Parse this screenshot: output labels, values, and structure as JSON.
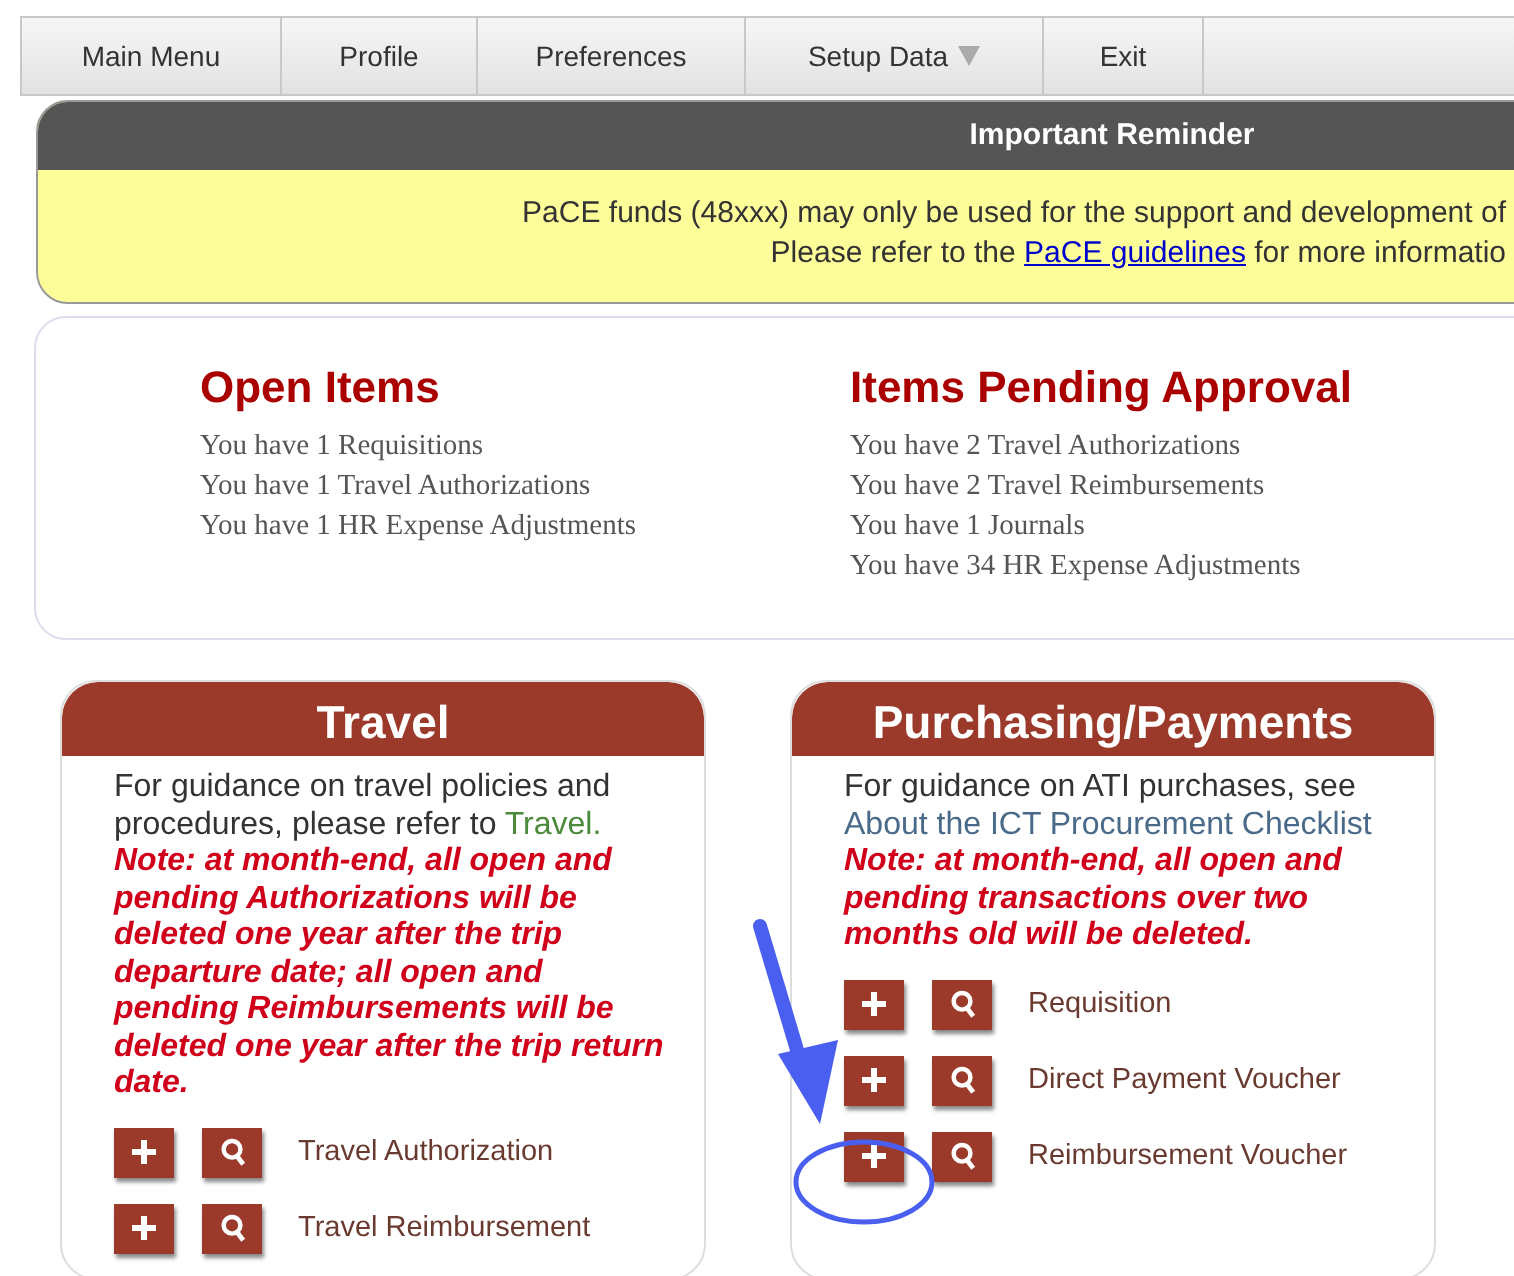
{
  "menu": [
    {
      "label": "Main Menu",
      "dropdown": false
    },
    {
      "label": "Profile",
      "dropdown": false
    },
    {
      "label": "Preferences",
      "dropdown": false
    },
    {
      "label": "Setup Data",
      "dropdown": true
    },
    {
      "label": "Exit",
      "dropdown": false
    }
  ],
  "reminder": {
    "title": "Important Reminder",
    "line_1": "PaCE funds (48xxx) may only be used for the support and development of",
    "line_2_before": "Please refer to the",
    "line_2_link": "PaCE guidelines",
    "line_2_after": "for more informatio"
  },
  "summary": [
    {
      "title": "Open Items",
      "lines": [
        "You have 1 Requisitions",
        "You have 1 Travel Authorizations",
        "You have 1 HR Expense Adjustments"
      ]
    },
    {
      "title": "Items Pending Approval",
      "lines": [
        "You have 2 Travel Authorizations",
        "You have 2 Travel Reimbursements",
        "You have 1 Journals",
        "You have 34 HR Expense Adjustments"
      ]
    }
  ],
  "cards": [
    {
      "title": "Travel",
      "guidance": "For guidance on travel policies and procedures, please refer to",
      "link": "Travel.",
      "note": "Note: at month-end, all open and pending Authorizations will be deleted one year after the trip departure date; all open and pending Reimbursements will be deleted one year after the trip return date.",
      "actions": [
        "Travel Authorization",
        "Travel Reimbursement"
      ]
    },
    {
      "title": "Purchasing/Payments",
      "guidance": "For guidance on ATI purchases, see",
      "link": "About the ICT Procurement Checklist",
      "note": "Note: at month-end, all open and pending transactions over two months old will be deleted.",
      "actions": [
        "Requisition",
        "Direct Payment Voucher",
        "Reimbursement Voucher"
      ]
    }
  ]
}
